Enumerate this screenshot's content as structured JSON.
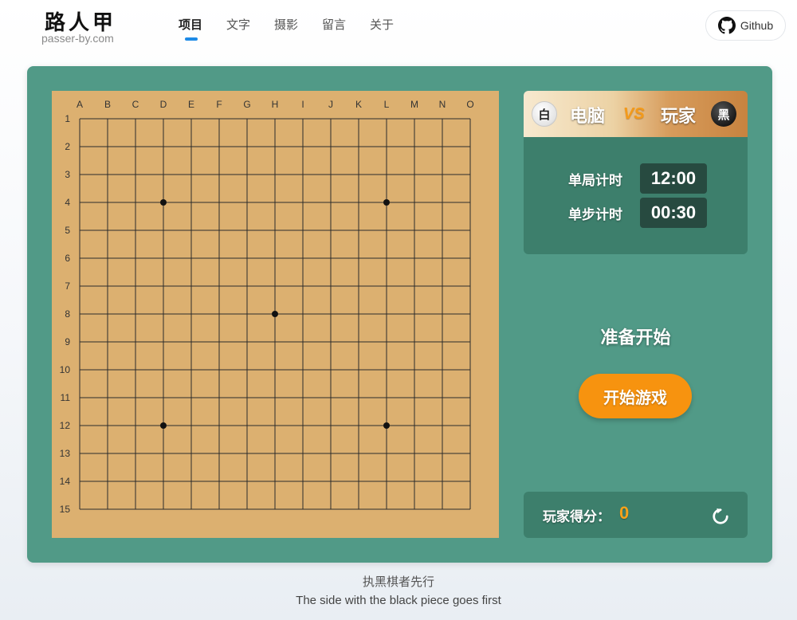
{
  "header": {
    "logo_title": "路人甲",
    "logo_subtitle": "passer-by.com",
    "nav": [
      {
        "label": "项目",
        "active": true
      },
      {
        "label": "文字",
        "active": false
      },
      {
        "label": "摄影",
        "active": false
      },
      {
        "label": "留言",
        "active": false
      },
      {
        "label": "关于",
        "active": false
      }
    ],
    "github_label": "Github",
    "github_icon": "github-icon"
  },
  "board": {
    "columns": [
      "A",
      "B",
      "C",
      "D",
      "E",
      "F",
      "G",
      "H",
      "I",
      "J",
      "K",
      "L",
      "M",
      "N",
      "O"
    ],
    "rows": [
      "1",
      "2",
      "3",
      "4",
      "5",
      "6",
      "7",
      "8",
      "9",
      "10",
      "11",
      "12",
      "13",
      "14",
      "15"
    ],
    "star_points": [
      [
        "D",
        "4"
      ],
      [
        "L",
        "4"
      ],
      [
        "H",
        "8"
      ],
      [
        "D",
        "12"
      ],
      [
        "L",
        "12"
      ]
    ],
    "stones": []
  },
  "players": {
    "left": {
      "stone": "白",
      "name": "电脑"
    },
    "vs": "VS",
    "right": {
      "stone": "黑",
      "name": "玩家"
    }
  },
  "timers": {
    "game_label": "单局计时",
    "game_value": "12:00",
    "step_label": "单步计时",
    "step_value": "00:30"
  },
  "status": "准备开始",
  "start_button": "开始游戏",
  "score": {
    "label": "玩家得分：",
    "value": "0",
    "refresh_icon": "refresh-icon"
  },
  "caption": {
    "cn": "执黑棋者先行",
    "en": "The side with the black piece goes first"
  },
  "colors": {
    "panel": "#519a87",
    "board": "#dcb070",
    "accent": "#f7930f",
    "nav_active": "#1d8ae6"
  }
}
